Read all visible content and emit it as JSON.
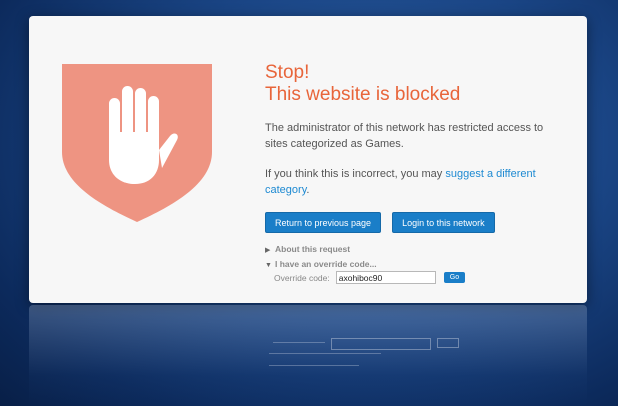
{
  "page": {
    "title_line1": "Stop!",
    "title_line2": "This website is blocked",
    "message": "The administrator of this network has restricted access to sites categorized as Games.",
    "incorrect_prefix": "If you think this is incorrect, you may ",
    "suggest_link": "suggest a different category",
    "incorrect_suffix": "."
  },
  "buttons": {
    "return_label": "Return to previous page",
    "login_label": "Login to this network"
  },
  "sections": {
    "about_label": "About this request",
    "override_toggle_label": "I have an override code...",
    "override_field_label": "Override code:",
    "override_value": "axohiboc90",
    "go_label": "Go"
  },
  "icons": {
    "shield": "shield-icon",
    "hand": "stop-hand-icon",
    "about_caret": "chevron-right-icon",
    "override_caret": "chevron-down-icon"
  },
  "colors": {
    "accent": "#e8653a",
    "shield": "#ee9482",
    "button": "#1a7ec8",
    "link": "#1e8ad2"
  }
}
